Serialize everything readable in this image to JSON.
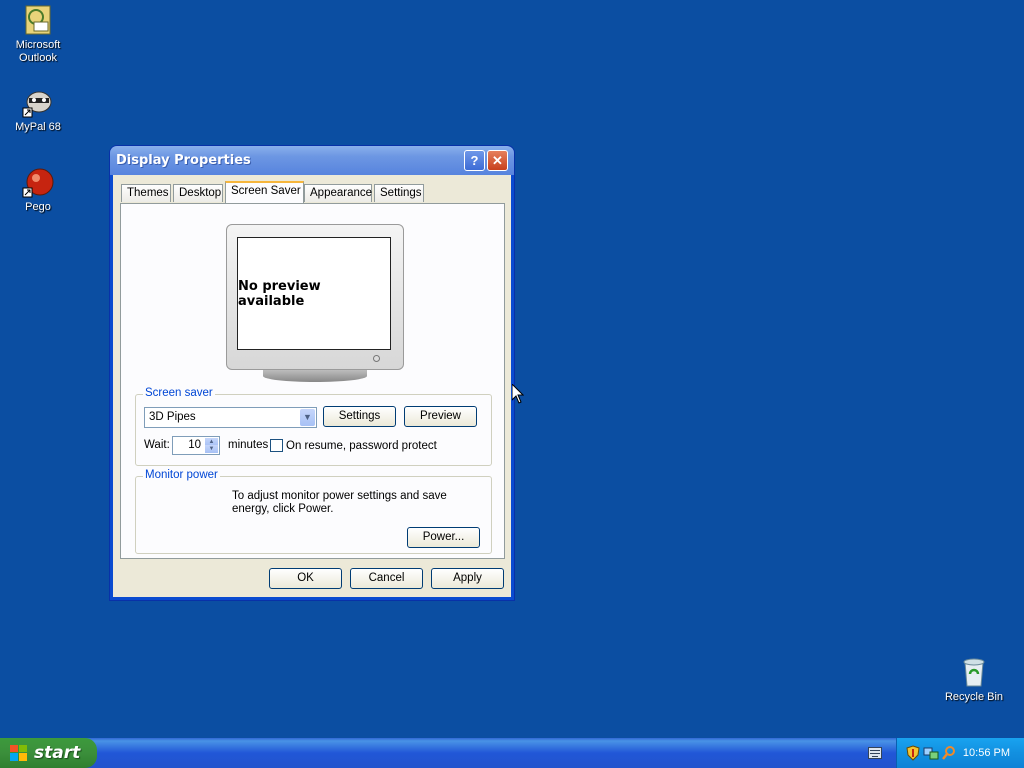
{
  "desktop": {
    "icons": [
      {
        "label": "Microsoft Outlook"
      },
      {
        "label": "MyPal 68"
      },
      {
        "label": "Pego"
      },
      {
        "label": "Recycle Bin"
      }
    ]
  },
  "window": {
    "title": "Display Properties",
    "help_glyph": "?",
    "close_glyph": "✕",
    "tabs": [
      "Themes",
      "Desktop",
      "Screen Saver",
      "Appearance",
      "Settings"
    ],
    "active_tab": "Screen Saver",
    "preview": {
      "text": "No preview available"
    },
    "screen_saver": {
      "group_title": "Screen saver",
      "selected": "3D Pipes",
      "settings_label": "Settings",
      "preview_label": "Preview",
      "wait_label": "Wait:",
      "wait_value": "10",
      "minutes_label": "minutes",
      "password_label": "On resume, password protect",
      "password_checked": false
    },
    "monitor_power": {
      "group_title": "Monitor power",
      "description": "To adjust monitor power settings and save energy, click Power.",
      "power_label": "Power..."
    },
    "buttons": {
      "ok": "OK",
      "cancel": "Cancel",
      "apply": "Apply"
    }
  },
  "taskbar": {
    "start_label": "start",
    "clock": "10:56 PM"
  },
  "colors": {
    "desktop": "#0b4ea2",
    "title_active": "#5784de",
    "group_title": "#0046d5"
  }
}
